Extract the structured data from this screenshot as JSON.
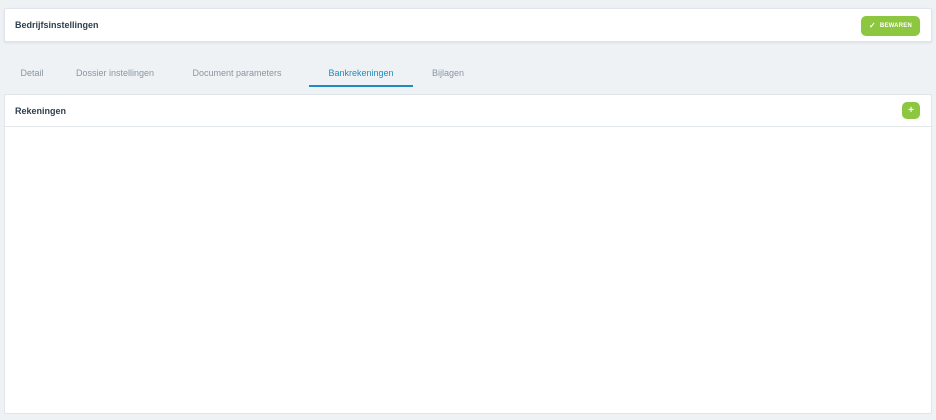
{
  "header": {
    "title": "Bedrijfsinstellingen",
    "save_label": "BEWAREN",
    "save_icon": "check-icon"
  },
  "tabs": [
    {
      "label": "Detail",
      "active": false
    },
    {
      "label": "Dossier instellingen",
      "active": false
    },
    {
      "label": "Document parameters",
      "active": false
    },
    {
      "label": "Bankrekeningen",
      "active": true
    },
    {
      "label": "Bijlagen",
      "active": false
    }
  ],
  "panel": {
    "title": "Rekeningen",
    "add_label": "+",
    "add_icon": "plus-icon"
  },
  "colors": {
    "accent_green": "#8dc63f",
    "active_tab": "#1e8bc3",
    "inactive_tab": "#8a96a3",
    "background": "#eef2f5"
  }
}
